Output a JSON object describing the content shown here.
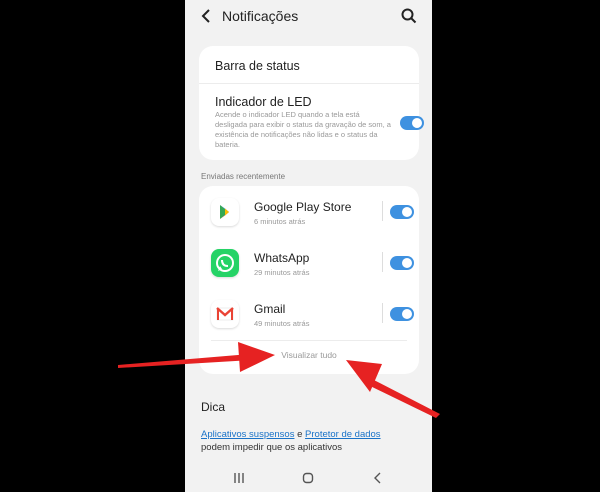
{
  "header": {
    "title": "Notificações"
  },
  "status_bar_row": {
    "label": "Barra de status"
  },
  "led": {
    "label": "Indicador de LED",
    "description": "Acende o indicador LED quando a tela está desligada para exibir o status da gravação de som, a existência de notificações não lidas e o status da bateria.",
    "enabled": true
  },
  "recent": {
    "section_label": "Enviadas recentemente",
    "apps": [
      {
        "name": "Google Play Store",
        "time": "6 minutos atrás",
        "icon": "google-play-icon",
        "enabled": true
      },
      {
        "name": "WhatsApp",
        "time": "29 minutos atrás",
        "icon": "whatsapp-icon",
        "enabled": true
      },
      {
        "name": "Gmail",
        "time": "49 minutos atrás",
        "icon": "gmail-icon",
        "enabled": true
      }
    ],
    "view_all": "Visualizar tudo"
  },
  "tip": {
    "heading": "Dica",
    "link1": "Aplicativos suspensos",
    "connector": " e ",
    "link2": "Protetor de dados",
    "rest": " podem impedir que os aplicativos"
  },
  "colors": {
    "toggle_on": "#3e91e0",
    "arrow": "#e62222",
    "link": "#1a73c8"
  }
}
